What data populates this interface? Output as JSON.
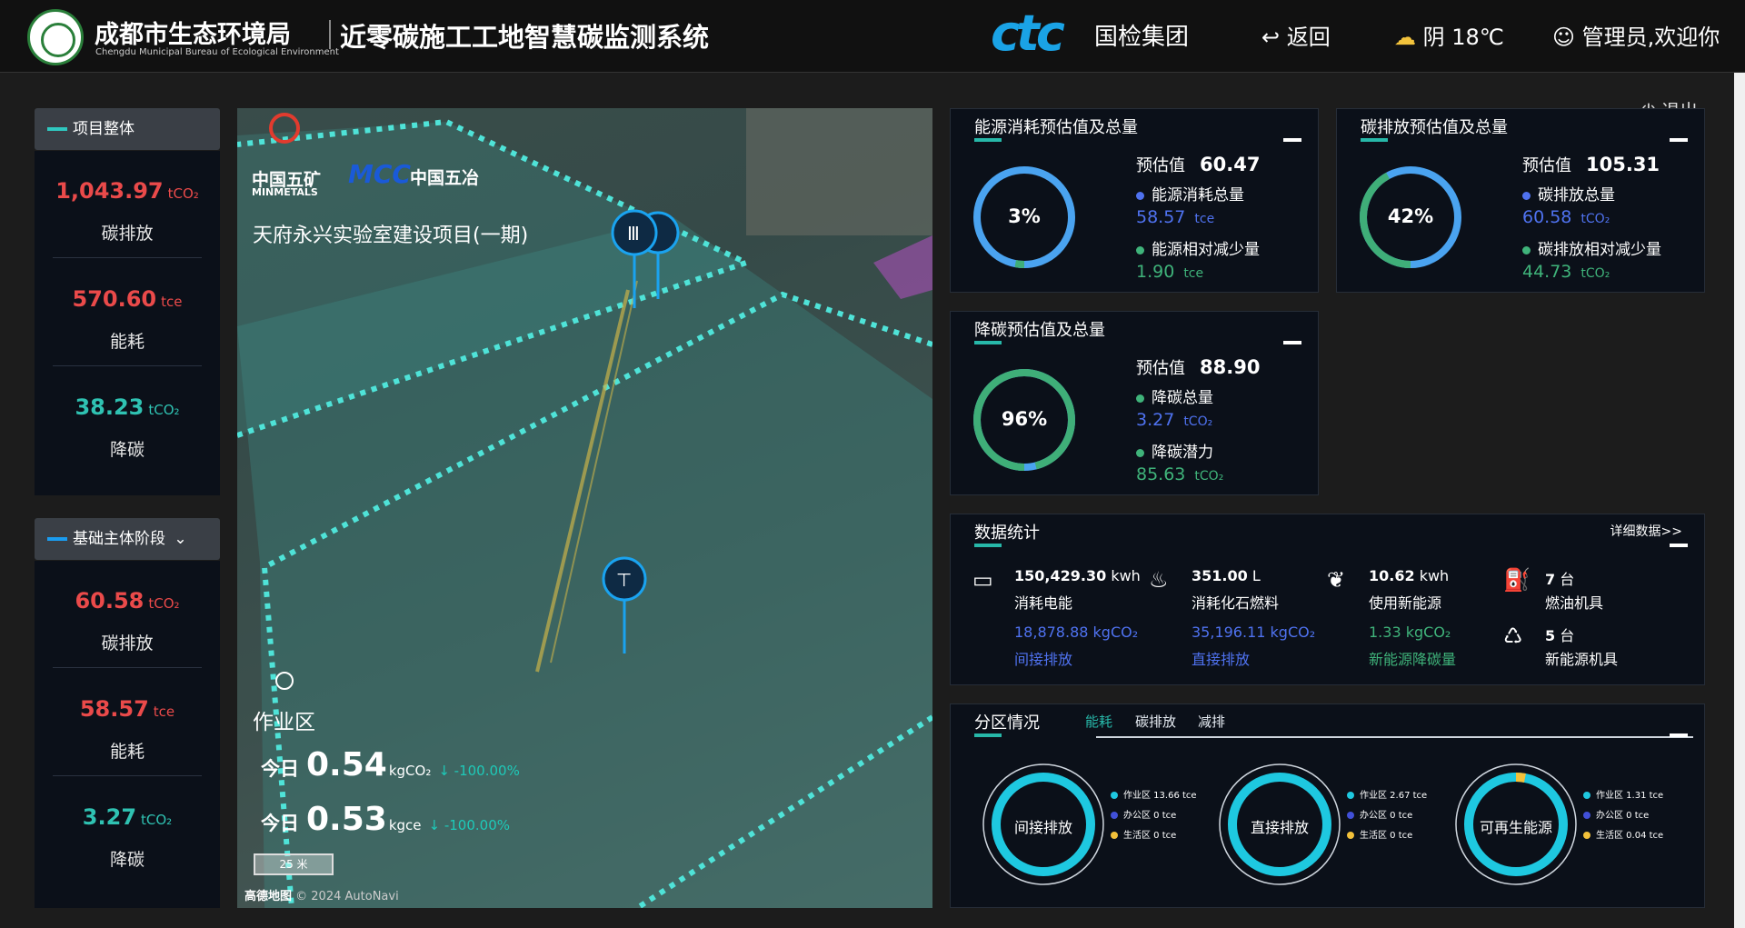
{
  "header": {
    "org_name": "成都市生态环境局",
    "org_name_en": "Chengdu Municipal Bureau of Ecological Environment",
    "system_title": "近零碳施工工地智慧碳监测系统",
    "partner_logo_text": "ctc",
    "partner_name": "国检集团",
    "back_label": "↩ 返回",
    "weather": "阴 18℃",
    "user": "管理员,欢迎你",
    "logout_label": "退出"
  },
  "sidebar": {
    "overall": {
      "title": "项目整体",
      "metrics": [
        {
          "value": "1,043.97",
          "unit": "tCO₂",
          "label": "碳排放"
        },
        {
          "value": "570.60",
          "unit": "tce",
          "label": "能耗"
        },
        {
          "value": "38.23",
          "unit": "tCO₂",
          "label": "降碳"
        }
      ]
    },
    "stage": {
      "title": "基础主体阶段",
      "metrics": [
        {
          "value": "60.58",
          "unit": "tCO₂",
          "label": "碳排放"
        },
        {
          "value": "58.57",
          "unit": "tce",
          "label": "能耗"
        },
        {
          "value": "3.27",
          "unit": "tCO₂",
          "label": "降碳"
        }
      ]
    }
  },
  "map": {
    "logo1": "中国五矿",
    "logo1_en": "MINMETALS",
    "logo2": "MCC",
    "logo2_cn": "中国五冶",
    "project_name": "天府永兴实验室建设项目(一期)",
    "zone": "作业区",
    "today_label": "今日",
    "row1_value": "0.54",
    "row1_unit": "kgCO₂",
    "row1_change": "↓ -100.00%",
    "row2_value": "0.53",
    "row2_unit": "kgce",
    "row2_change": "↓ -100.00%",
    "scale": "25 米",
    "credit_brand": "高德地图",
    "credit": "© 2024 AutoNavi"
  },
  "energy_card": {
    "title": "能源消耗预估值及总量",
    "percent": "3%",
    "percent_value": 0.03,
    "estimate_label": "预估值",
    "estimate_value": "60.47",
    "item1_label": "能源消耗总量",
    "item1_value": "58.57",
    "item1_unit": "tce",
    "item2_label": "能源相对减少量",
    "item2_value": "1.90",
    "item2_unit": "tce"
  },
  "carbon_card": {
    "title": "碳排放预估值及总量",
    "percent": "42%",
    "percent_value": 0.42,
    "estimate_label": "预估值",
    "estimate_value": "105.31",
    "item1_label": "碳排放总量",
    "item1_value": "60.58",
    "item1_unit": "tCO₂",
    "item2_label": "碳排放相对减少量",
    "item2_value": "44.73",
    "item2_unit": "tCO₂"
  },
  "reduce_card": {
    "title": "降碳预估值及总量",
    "percent": "96%",
    "percent_value": 0.96,
    "estimate_label": "预估值",
    "estimate_value": "88.90",
    "item1_label": "降碳总量",
    "item1_value": "3.27",
    "item1_unit": "tCO₂",
    "item2_label": "降碳潜力",
    "item2_value": "85.63",
    "item2_unit": "tCO₂"
  },
  "stats": {
    "title": "数据统计",
    "detail_link": "详细数据>>",
    "electricity": {
      "value": "150,429.30",
      "unit": "kwh",
      "label": "消耗电能",
      "sub_value": "18,878.88",
      "sub_unit": "kgCO₂",
      "sub_label": "间接排放"
    },
    "fuel": {
      "value": "351.00",
      "unit": "L",
      "label": "消耗化石燃料",
      "sub_value": "35,196.11",
      "sub_unit": "kgCO₂",
      "sub_label": "直接排放"
    },
    "renewable": {
      "value": "10.62",
      "unit": "kwh",
      "label": "使用新能源",
      "sub_value": "1.33",
      "sub_unit": "kgCO₂",
      "sub_label": "新能源降碳量"
    },
    "fuel_machines": {
      "value": "7",
      "unit": "台",
      "label": "燃油机具"
    },
    "new_machines": {
      "value": "5",
      "unit": "台",
      "label": "新能源机具"
    }
  },
  "zones": {
    "title": "分区情况",
    "tabs": [
      "能耗",
      "碳排放",
      "减排"
    ],
    "active_tab": 0,
    "rings": [
      {
        "label": "间接排放",
        "legend": [
          "作业区 13.66 tce",
          "办公区 0 tce",
          "生活区 0 tce"
        ]
      },
      {
        "label": "直接排放",
        "legend": [
          "作业区 2.67 tce",
          "办公区 0 tce",
          "生活区 0 tce"
        ]
      },
      {
        "label": "可再生能源",
        "legend": [
          "作业区 1.31 tce",
          "办公区 0 tce",
          "生活区 0.04 tce"
        ]
      }
    ],
    "legend_colors": [
      "#1ec8e0",
      "#4150d8",
      "#f3c13a"
    ]
  },
  "colors": {
    "accent_teal": "#27b8a9",
    "ring_blue": "#4aa3f0",
    "ring_green": "#3fae78",
    "red": "#ea4a4a",
    "indigo": "#4f72f0"
  }
}
